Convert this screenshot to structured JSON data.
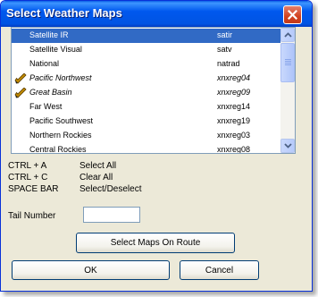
{
  "window": {
    "title": "Select Weather Maps"
  },
  "maps": [
    {
      "name": "Satellite IR",
      "code": "satir",
      "selected": true,
      "checked": false
    },
    {
      "name": "Satellite Visual",
      "code": "satv",
      "selected": false,
      "checked": false
    },
    {
      "name": "National",
      "code": "natrad",
      "selected": false,
      "checked": false
    },
    {
      "name": "Pacific Northwest",
      "code": "xnxreg04",
      "selected": false,
      "checked": true
    },
    {
      "name": "Great Basin",
      "code": "xnxreg09",
      "selected": false,
      "checked": true
    },
    {
      "name": "Far West",
      "code": "xnxreg14",
      "selected": false,
      "checked": false
    },
    {
      "name": "Pacific Southwest",
      "code": "xnxreg19",
      "selected": false,
      "checked": false
    },
    {
      "name": "Northern Rockies",
      "code": "xnxreg03",
      "selected": false,
      "checked": false
    },
    {
      "name": "Central Rockies",
      "code": "xnxreg08",
      "selected": false,
      "checked": false
    }
  ],
  "shortcuts": [
    {
      "keys": "CTRL + A",
      "action": "Select All"
    },
    {
      "keys": "CTRL + C",
      "action": "Clear All"
    },
    {
      "keys": "SPACE BAR",
      "action": "Select/Deselect"
    }
  ],
  "tail_number": {
    "label": "Tail Number",
    "value": ""
  },
  "buttons": {
    "route": "Select Maps On Route",
    "ok": "OK",
    "cancel": "Cancel"
  },
  "colors": {
    "title_bar": "#0054e3",
    "selection": "#316ac5",
    "dialog_bg": "#ece9d8",
    "close_button": "#d2421f",
    "check_mark": "#c08a00"
  },
  "icons": {
    "close": "close-icon",
    "checked_row": "pencil-check-icon",
    "scroll_up": "chevron-up-icon",
    "scroll_down": "chevron-down-icon"
  }
}
